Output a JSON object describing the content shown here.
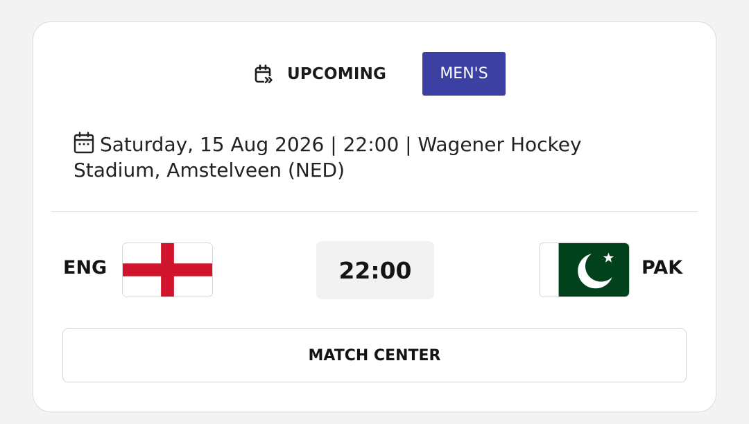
{
  "match": {
    "status": "UPCOMING",
    "status_icon": "calendar-forward-icon",
    "gender": "MEN'S",
    "info_icon": "calendar-icon",
    "info": "Saturday, 15 Aug 2026 | 22:00 | Wagener Hockey Stadium, Amstelveen (NED)",
    "time": "22:00",
    "home_team": {
      "code": "ENG",
      "flag": "england-flag"
    },
    "away_team": {
      "code": "PAK",
      "flag": "pakistan-flag"
    },
    "cta_label": "MATCH CENTER"
  },
  "colors": {
    "badge": "#3d40a3",
    "england_red": "#cf142b",
    "pakistan_green": "#01411c"
  }
}
